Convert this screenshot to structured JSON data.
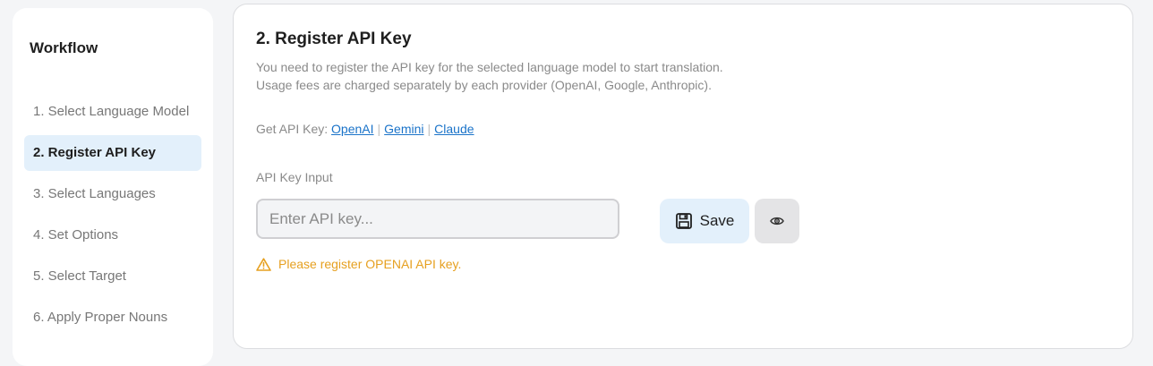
{
  "sidebar": {
    "title": "Workflow",
    "steps": [
      {
        "label": "1. Select Language Model"
      },
      {
        "label": "2. Register API Key"
      },
      {
        "label": "3. Select Languages"
      },
      {
        "label": "4. Set Options"
      },
      {
        "label": "5. Select Target"
      },
      {
        "label": "6. Apply Proper Nouns"
      }
    ],
    "active_index": 1
  },
  "main": {
    "title": "2. Register API Key",
    "description_line1": "You need to register the API key for the selected language model to start translation.",
    "description_line2": "Usage fees are charged separately by each provider (OpenAI, Google, Anthropic).",
    "get_key_prefix": "Get API Key:",
    "links": [
      {
        "label": "OpenAI"
      },
      {
        "label": "Gemini"
      },
      {
        "label": "Claude"
      }
    ],
    "link_separator": "|",
    "input_label": "API Key Input",
    "input_placeholder": "Enter API key...",
    "input_value": "",
    "save_label": "Save",
    "warning_text": "Please register OPENAI API key."
  },
  "colors": {
    "accent": "#1a73c9",
    "active_bg": "#e3f0fb",
    "warning": "#e6a020"
  },
  "icons": {
    "save": "floppy-disk-icon",
    "toggle_visibility": "eye-icon",
    "warning": "warning-triangle-icon"
  }
}
